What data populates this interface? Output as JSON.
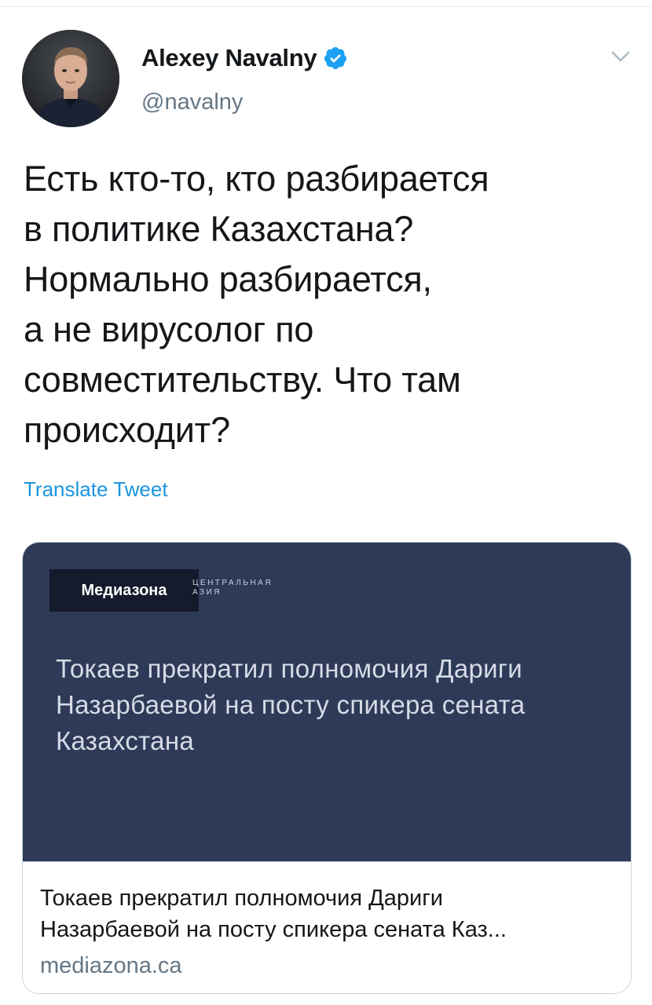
{
  "author": {
    "name": "Alexey Navalny",
    "handle": "@navalny",
    "verified": true
  },
  "icons": {
    "verified": "verified-badge-icon",
    "menu": "chevron-down-icon"
  },
  "colors": {
    "link": "#1b95e0",
    "verified": "#1da1f2",
    "card_bg": "#2e3a58"
  },
  "tweet": {
    "text": "Есть кто-то, кто разбирается\nв политике Казахстана?\nНормально разбирается,\nа не вирусолог по\nсовместительству. Что там\nпроисходит?",
    "translate_label": "Translate Tweet"
  },
  "card": {
    "brand": "Медиазона",
    "brand_sub": "ЦЕНТРАЛЬНАЯ АЗИЯ",
    "image_headline": "Токаев прекратил полномочия Дариги Назарбаевой на посту спикера сената Казахстана",
    "title": "Токаев прекратил полномочия Дариги\nНазарбаевой на посту спикера сената Каз...",
    "domain": "mediazona.ca"
  }
}
